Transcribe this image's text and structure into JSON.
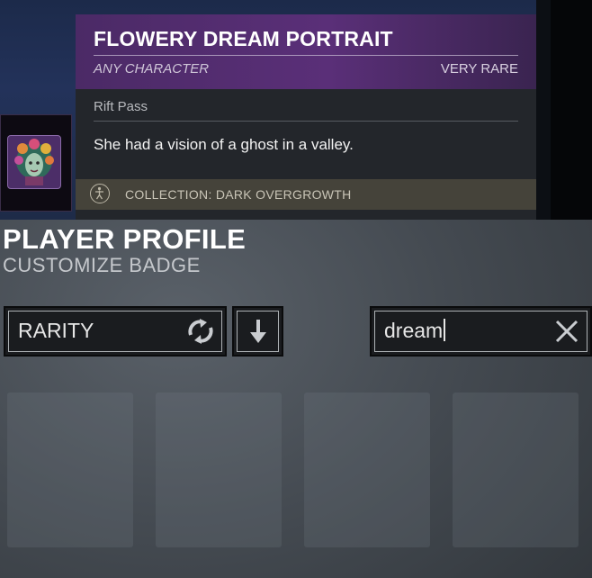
{
  "tooltip": {
    "title": "FLOWERY DREAM PORTRAIT",
    "subtitle": "ANY CHARACTER",
    "rarity": "VERY RARE",
    "source": "Rift Pass",
    "description": "She had a vision of a ghost in a valley.",
    "collection": "COLLECTION: DARK OVERGROWTH",
    "colors": {
      "header": "#5a2f78",
      "footer": "#45433a"
    }
  },
  "page": {
    "title": "PLAYER PROFILE",
    "subtitle": "CUSTOMIZE BADGE"
  },
  "controls": {
    "rarity_filter": {
      "label": "RARITY",
      "icon": "refresh-icon"
    },
    "sort_button": {
      "icon": "sort-arrow-down-icon"
    },
    "search": {
      "value": "dream",
      "clear_icon": "close-icon"
    }
  },
  "cards": [
    {
      "state": "empty"
    },
    {
      "state": "empty"
    },
    {
      "state": "empty"
    },
    {
      "state": "empty"
    }
  ]
}
